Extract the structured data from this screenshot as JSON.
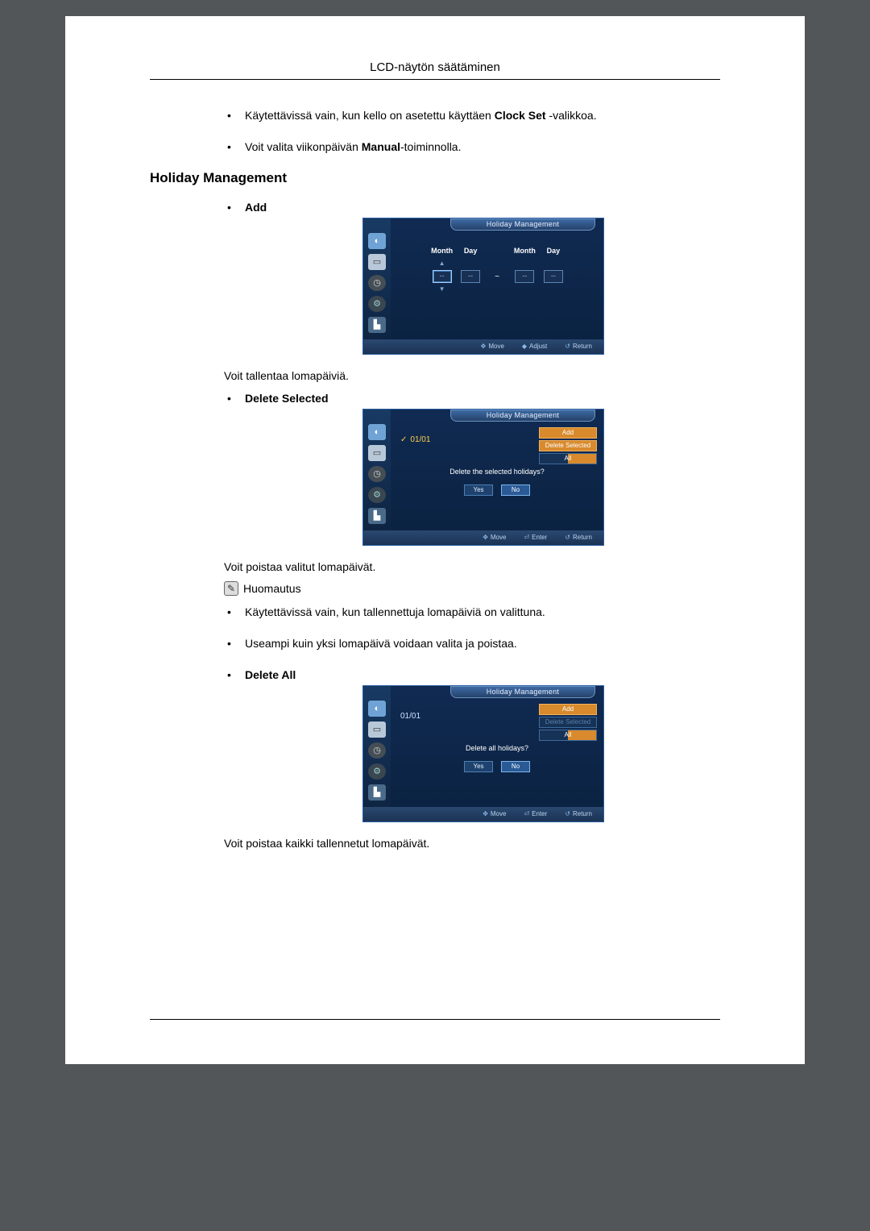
{
  "header": {
    "title": "LCD-näytön säätäminen"
  },
  "intro_bullets": [
    {
      "pre": "Käytettävissä vain, kun kello on asetettu käyttäen ",
      "bold": "Clock Set",
      "post": " -valikkoa."
    },
    {
      "pre": "Voit valita viikonpäivän ",
      "bold": "Manual",
      "post": "-toiminnolla."
    }
  ],
  "heading": "Holiday Management",
  "add": {
    "label": "Add",
    "osd_title": "Holiday Management",
    "cols": {
      "month": "Month",
      "day": "Day"
    },
    "dash": "--",
    "footer": {
      "move": "Move",
      "adjust": "Adjust",
      "return": "Return"
    },
    "caption": "Voit tallentaa lomapäiviä."
  },
  "del_sel": {
    "label": "Delete Selected",
    "osd_title": "Holiday Management",
    "item": "01/01",
    "menu": {
      "add": "Add",
      "delsel": "Delete Selected",
      "all": "All"
    },
    "prompt": "Delete the selected holidays?",
    "yes": "Yes",
    "no": "No",
    "footer": {
      "move": "Move",
      "enter": "Enter",
      "return": "Return"
    },
    "caption": "Voit poistaa valitut lomapäivät."
  },
  "note": {
    "label": "Huomautus",
    "bullets": [
      "Käytettävissä vain, kun tallennettuja lomapäiviä on valittuna.",
      "Useampi kuin yksi lomapäivä voidaan valita ja poistaa."
    ]
  },
  "del_all": {
    "label": "Delete All",
    "osd_title": "Holiday Management",
    "item": "01/01",
    "menu": {
      "add": "Add",
      "delsel": "Delete Selected",
      "all": "All"
    },
    "prompt": "Delete all holidays?",
    "yes": "Yes",
    "no": "No",
    "footer": {
      "move": "Move",
      "enter": "Enter",
      "return": "Return"
    },
    "caption": "Voit poistaa kaikki tallennetut lomapäivät."
  }
}
